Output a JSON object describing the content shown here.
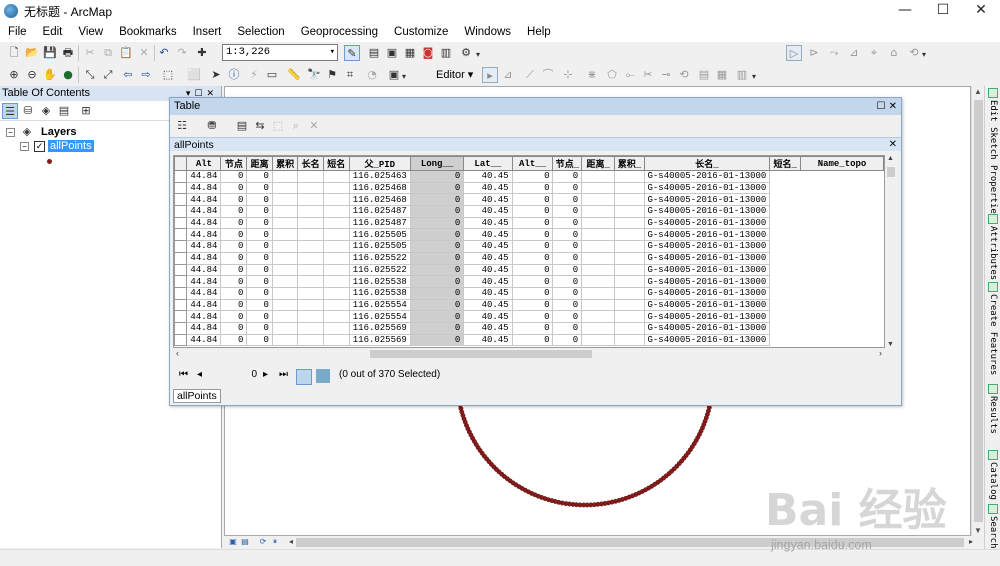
{
  "window": {
    "title": "无标题 - ArcMap",
    "controls": [
      "—",
      "☐",
      "✕"
    ]
  },
  "menu": [
    "File",
    "Edit",
    "View",
    "Bookmarks",
    "Insert",
    "Selection",
    "Geoprocessing",
    "Customize",
    "Windows",
    "Help"
  ],
  "toolbar": {
    "scale_value": "1:3,226",
    "editor_label": "Editor ▾"
  },
  "toc": {
    "title": "Table Of Contents",
    "root_label": "Layers",
    "layer_label": "allPoints",
    "layer_checked": "✓",
    "expander_root": "−",
    "expander_layer": "−",
    "point_color": "#8b1a1a"
  },
  "right_dock": [
    "Edit Sketch Properties",
    "Attributes",
    "Create Features",
    "Results",
    "Catalog",
    "Search"
  ],
  "table_window": {
    "title": "Table",
    "layer_tab": "allPoints",
    "tab_chip": "allPoints",
    "columns": [
      "",
      "Alt",
      "节点",
      "距离",
      "累积",
      "长名",
      "短名",
      "父_PID",
      "Long__",
      "Lat__",
      "Alt__",
      "节点_",
      "距离_",
      "累积_",
      "长名_",
      "短名_",
      "Name_topo"
    ],
    "rows": [
      [
        "44.84",
        "0",
        "0",
        "",
        "",
        "",
        "116.025463",
        "0",
        "40.45",
        "0",
        "0",
        "",
        "",
        "G-s40005-2016-01-13000"
      ],
      [
        "44.84",
        "0",
        "0",
        "",
        "",
        "",
        "116.025468",
        "0",
        "40.45",
        "0",
        "0",
        "",
        "",
        "G-s40005-2016-01-13000"
      ],
      [
        "44.84",
        "0",
        "0",
        "",
        "",
        "",
        "116.025468",
        "0",
        "40.45",
        "0",
        "0",
        "",
        "",
        "G-s40005-2016-01-13000"
      ],
      [
        "44.84",
        "0",
        "0",
        "",
        "",
        "",
        "116.025487",
        "0",
        "40.45",
        "0",
        "0",
        "",
        "",
        "G-s40005-2016-01-13000"
      ],
      [
        "44.84",
        "0",
        "0",
        "",
        "",
        "",
        "116.025487",
        "0",
        "40.45",
        "0",
        "0",
        "",
        "",
        "G-s40005-2016-01-13000"
      ],
      [
        "44.84",
        "0",
        "0",
        "",
        "",
        "",
        "116.025505",
        "0",
        "40.45",
        "0",
        "0",
        "",
        "",
        "G-s40005-2016-01-13000"
      ],
      [
        "44.84",
        "0",
        "0",
        "",
        "",
        "",
        "116.025505",
        "0",
        "40.45",
        "0",
        "0",
        "",
        "",
        "G-s40005-2016-01-13000"
      ],
      [
        "44.84",
        "0",
        "0",
        "",
        "",
        "",
        "116.025522",
        "0",
        "40.45",
        "0",
        "0",
        "",
        "",
        "G-s40005-2016-01-13000"
      ],
      [
        "44.84",
        "0",
        "0",
        "",
        "",
        "",
        "116.025522",
        "0",
        "40.45",
        "0",
        "0",
        "",
        "",
        "G-s40005-2016-01-13000"
      ],
      [
        "44.84",
        "0",
        "0",
        "",
        "",
        "",
        "116.025538",
        "0",
        "40.45",
        "0",
        "0",
        "",
        "",
        "G-s40005-2016-01-13000"
      ],
      [
        "44.84",
        "0",
        "0",
        "",
        "",
        "",
        "116.025538",
        "0",
        "40.45",
        "0",
        "0",
        "",
        "",
        "G-s40005-2016-01-13000"
      ],
      [
        "44.84",
        "0",
        "0",
        "",
        "",
        "",
        "116.025554",
        "0",
        "40.45",
        "0",
        "0",
        "",
        "",
        "G-s40005-2016-01-13000"
      ],
      [
        "44.84",
        "0",
        "0",
        "",
        "",
        "",
        "116.025554",
        "0",
        "40.45",
        "0",
        "0",
        "",
        "",
        "G-s40005-2016-01-13000"
      ],
      [
        "44.84",
        "0",
        "0",
        "",
        "",
        "",
        "116.025569",
        "0",
        "40.45",
        "0",
        "0",
        "",
        "",
        "G-s40005-2016-01-13000"
      ],
      [
        "44.84",
        "0",
        "0",
        "",
        "",
        "",
        "116.025569",
        "0",
        "40.45",
        "0",
        "0",
        "",
        "",
        "G-s40005-2016-01-13000"
      ]
    ],
    "record_index": "0",
    "selection_status": "(0 out of 370 Selected)"
  },
  "watermark": {
    "text": "Bai 经验",
    "url": "jingyan.baidu.com"
  }
}
